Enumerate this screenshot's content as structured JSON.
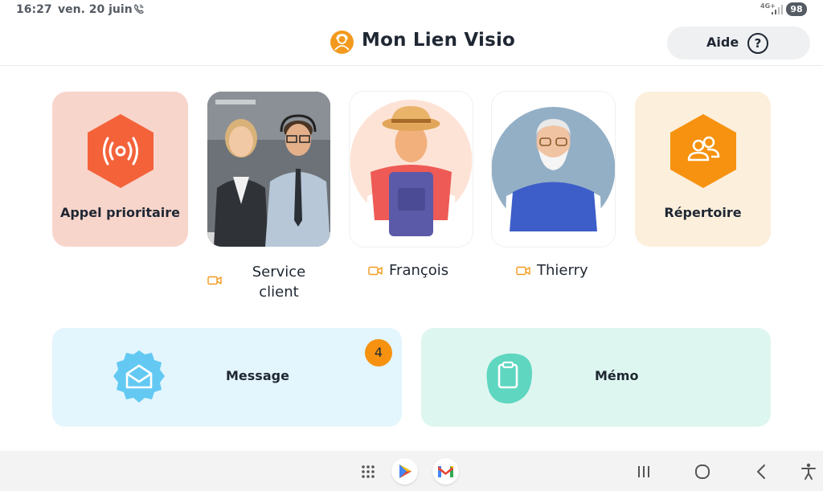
{
  "status_bar": {
    "time": "16:27",
    "date": "ven. 20 juin",
    "network": "4G+",
    "battery": "98"
  },
  "header": {
    "title": "Mon Lien Visio",
    "help_label": "Aide",
    "help_icon": "?"
  },
  "tiles": {
    "priority_call": "Appel prioritaire",
    "directory": "Répertoire"
  },
  "contacts": [
    {
      "name": "Service client",
      "icon": "video-camera-icon"
    },
    {
      "name": "François",
      "icon": "video-camera-icon"
    },
    {
      "name": "Thierry",
      "icon": "video-camera-icon"
    }
  ],
  "cards": {
    "message_label": "Message",
    "message_badge": "4",
    "memo_label": "Mémo"
  },
  "colors": {
    "accent_orange": "#f6920f",
    "priority_red": "#f4623a",
    "message_blue": "#63c9f3",
    "memo_green": "#5fd6c0"
  }
}
